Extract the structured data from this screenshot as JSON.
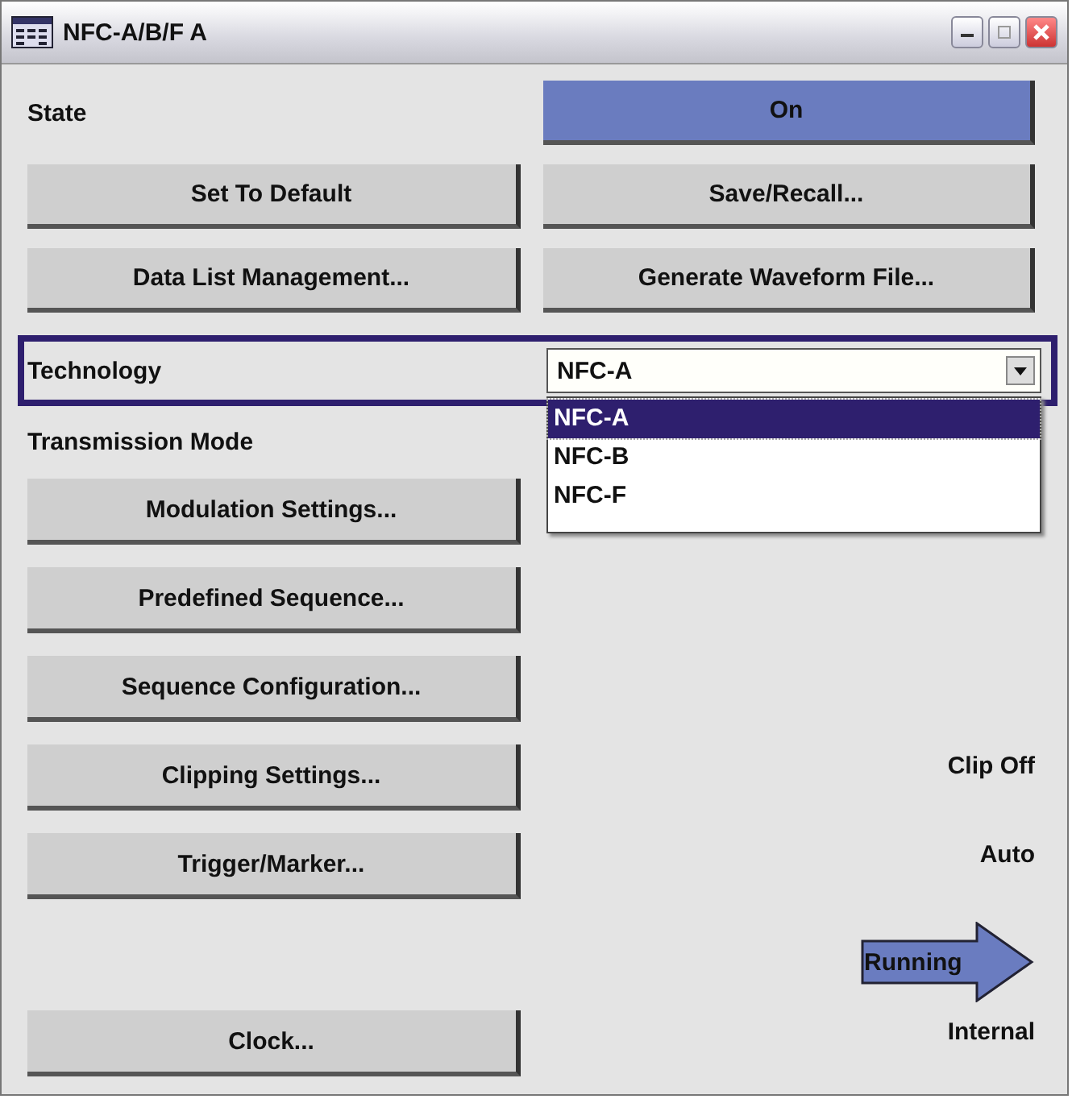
{
  "window": {
    "title": "NFC-A/B/F A"
  },
  "state": {
    "label": "State",
    "value": "On",
    "on": true
  },
  "top_buttons": [
    [
      "Set To Default",
      "Save/Recall..."
    ],
    [
      "Data List Management...",
      "Generate Waveform File..."
    ]
  ],
  "technology": {
    "label": "Technology",
    "value": "NFC-A",
    "expanded": true,
    "options": [
      {
        "label": "NFC-A",
        "selected": true
      },
      {
        "label": "NFC-B",
        "selected": false
      },
      {
        "label": "NFC-F",
        "selected": false
      }
    ]
  },
  "transmission_mode": {
    "label": "Transmission Mode"
  },
  "rows": [
    {
      "button": "Modulation Settings..."
    },
    {
      "button": "Predefined Sequence..."
    },
    {
      "button": "Sequence Configuration..."
    },
    {
      "button": "Clipping Settings...",
      "status": {
        "kind": "text",
        "text": "Clip Off"
      }
    },
    {
      "button": "Trigger/Marker...",
      "status": {
        "kind": "text",
        "text": "Auto"
      }
    },
    {
      "status": {
        "kind": "arrow",
        "text": "Running"
      }
    },
    {
      "button": "Clock...",
      "status": {
        "kind": "text",
        "text": "Internal"
      }
    }
  ]
}
